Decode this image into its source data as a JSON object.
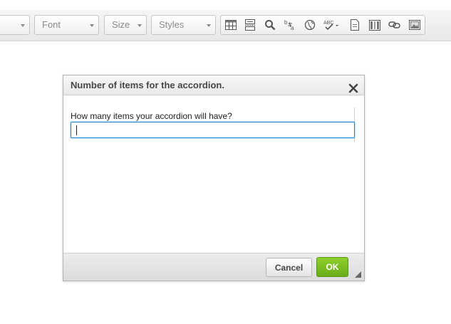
{
  "toolbar": {
    "format_combo": {
      "label": ""
    },
    "font_combo": {
      "label": "Font"
    },
    "size_combo": {
      "label": "Size"
    },
    "styles_combo": {
      "label": "Styles"
    },
    "buttons": [
      "table-icon",
      "page-break-icon",
      "find-icon",
      "replace-icon",
      "globe-icon",
      "spellcheck-icon",
      "document-icon",
      "columns-icon",
      "link-icon",
      "image-icon"
    ],
    "spellcheck_text": "ABC"
  },
  "dialog": {
    "title": "Number of items for the accordion.",
    "field_label": "How many items your accordion will have?",
    "field_value": "",
    "cancel_label": "Cancel",
    "ok_label": "OK"
  },
  "colors": {
    "ok_button": "#7bbf24",
    "input_focus": "#1e87c7"
  }
}
